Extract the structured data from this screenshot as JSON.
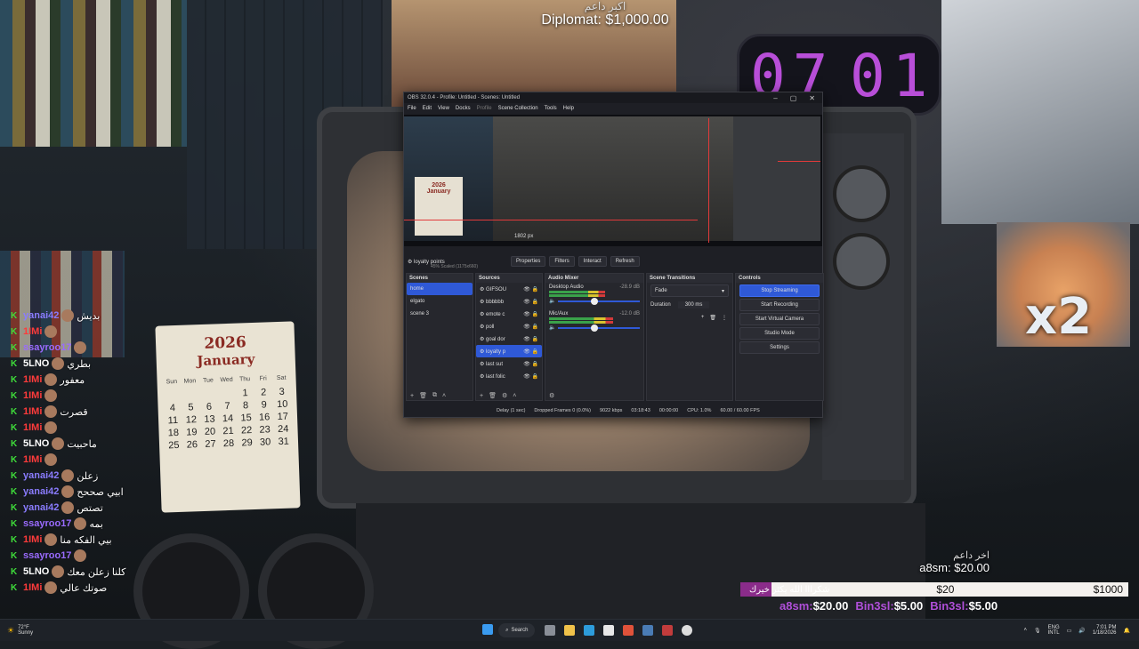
{
  "overlay": {
    "top_alert": {
      "title": "اكبر داعم",
      "amount": "Diplomat: $1,000.00"
    },
    "clock": {
      "hours": "07",
      "minutes": "01"
    },
    "calendar": {
      "year": "2026",
      "month": "January",
      "weekdays": [
        "Sun",
        "Mon",
        "Tue",
        "Wed",
        "Thu",
        "Fri",
        "Sat"
      ],
      "days": [
        "",
        "",
        "",
        "",
        "1",
        "2",
        "3",
        "4",
        "5",
        "6",
        "7",
        "8",
        "9",
        "10",
        "11",
        "12",
        "13",
        "14",
        "15",
        "16",
        "17",
        "18",
        "19",
        "20",
        "21",
        "22",
        "23",
        "24",
        "25",
        "26",
        "27",
        "28",
        "29",
        "30",
        "31"
      ]
    },
    "multiplier": "x2",
    "latest_donor": {
      "title": "اخر داعم",
      "amount": "a8sm: $20.00"
    },
    "goal_bar": {
      "label": "شكرااا الله يكثر خيرك",
      "current": "$20",
      "target": "$1000",
      "progress": 0.02
    },
    "ticker": [
      {
        "name": "a8sm:",
        "amount": "$20.00"
      },
      {
        "name": "Bin3sl:",
        "amount": "$5.00"
      },
      {
        "name": "Bin3sl:",
        "amount": "$5.00"
      }
    ]
  },
  "chat": [
    {
      "user": "yanai42",
      "color": "#8a7cff",
      "text": "بديش"
    },
    {
      "user": "1IMi",
      "color": "#ff3b3b",
      "text": ""
    },
    {
      "user": "ssayroo17",
      "color": "#9a6bff",
      "text": ""
    },
    {
      "user": "5LNO",
      "color": "#ffffff",
      "text": "بطري"
    },
    {
      "user": "1IMi",
      "color": "#ff3b3b",
      "text": "معفور"
    },
    {
      "user": "1IMi",
      "color": "#ff3b3b",
      "text": ""
    },
    {
      "user": "1IMi",
      "color": "#ff3b3b",
      "text": "قصرت"
    },
    {
      "user": "1IMi",
      "color": "#ff3b3b",
      "text": ""
    },
    {
      "user": "5LNO",
      "color": "#ffffff",
      "text": "ماحبيت"
    },
    {
      "user": "1IMi",
      "color": "#ff3b3b",
      "text": ""
    },
    {
      "user": "yanai42",
      "color": "#8a7cff",
      "text": "زعلن"
    },
    {
      "user": "yanai42",
      "color": "#8a7cff",
      "text": "ابيي صححح"
    },
    {
      "user": "yanai42",
      "color": "#8a7cff",
      "text": "تصتص"
    },
    {
      "user": "ssayroo17",
      "color": "#9a6bff",
      "text": "بمه"
    },
    {
      "user": "1IMi",
      "color": "#ff3b3b",
      "text": "بيي الفكه منا"
    },
    {
      "user": "ssayroo17",
      "color": "#9a6bff",
      "text": ""
    },
    {
      "user": "5LNO",
      "color": "#ffffff",
      "text": "كلنا زعلن معك"
    },
    {
      "user": "1IMi",
      "color": "#ff3b3b",
      "text": "صوتك عالي"
    }
  ],
  "obs": {
    "title": "OBS 32.0.4 - Profile: Untitled - Scenes: Untitled",
    "menu": [
      "File",
      "Edit",
      "View",
      "Docks",
      "Profile",
      "Scene Collection",
      "Tools",
      "Help"
    ],
    "preview": {
      "scale": "45%  Scaled (1175x660)",
      "coord": "1802 px",
      "cal_year": "2026",
      "cal_month": "January"
    },
    "source_toolbar": {
      "current": "loyalty points",
      "buttons": [
        "Properties",
        "Filters",
        "Interact",
        "Refresh"
      ]
    },
    "scenes": {
      "title": "Scenes",
      "items": [
        "home",
        "elgato",
        "scene 3"
      ],
      "selected": 0
    },
    "sources": {
      "title": "Sources",
      "items": [
        "GIFSOU",
        "bbbbbb",
        "emote c",
        "poll",
        "goal dor",
        "loyalty p",
        "last sut",
        "last folic"
      ],
      "selected": 5
    },
    "mixer": {
      "title": "Audio Mixer",
      "channels": [
        {
          "name": "Desktop Audio",
          "db": "-28.9 dB",
          "level": 0.7
        },
        {
          "name": "Mic/Aux",
          "db": "-12.0 dB",
          "level": 0.8
        }
      ]
    },
    "transitions": {
      "title": "Scene Transitions",
      "type": "Fade",
      "duration_label": "Duration",
      "duration": "300 ms"
    },
    "controls": {
      "title": "Controls",
      "buttons": [
        "Stop Streaming",
        "Start Recording",
        "Start Virtual Camera",
        "Studio Mode",
        "Settings"
      ]
    },
    "status": {
      "delay": "Delay (1 sec)",
      "dropped": "Dropped Frames 0 (0.0%)",
      "kbps": "9022 kbps",
      "time": "03:18:43",
      "rec": "00:00:00",
      "cpu": "CPU: 1.0%",
      "fps": "60.00 / 60.00 FPS"
    }
  },
  "taskbar": {
    "weather_temp": "72°F",
    "weather_text": "Sunny",
    "search": "Search",
    "lang": "ENG",
    "lang2": "INTL",
    "time": "7:01 PM",
    "date": "1/18/2026"
  }
}
